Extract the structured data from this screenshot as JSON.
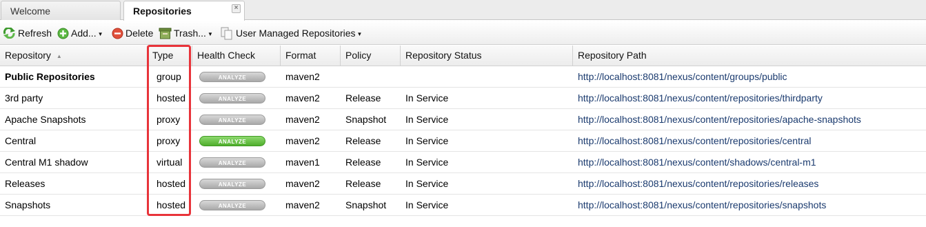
{
  "tabs": [
    {
      "label": "Welcome"
    },
    {
      "label": "Repositories",
      "close_glyph": "×"
    }
  ],
  "toolbar": {
    "refresh": "Refresh",
    "add": "Add...",
    "delete": "Delete",
    "trash": "Trash...",
    "user_managed": "User Managed Repositories"
  },
  "columns": {
    "repository": "Repository",
    "type": "Type",
    "health": "Health Check",
    "format": "Format",
    "policy": "Policy",
    "status": "Repository Status",
    "path": "Repository Path"
  },
  "rows": [
    {
      "name": "Public Repositories",
      "type": "group",
      "health": "ANALYZE",
      "health_state": "gray",
      "format": "maven2",
      "policy": "",
      "status": "",
      "path": "http://localhost:8081/nexus/content/groups/public"
    },
    {
      "name": "3rd party",
      "type": "hosted",
      "health": "ANALYZE",
      "health_state": "gray",
      "format": "maven2",
      "policy": "Release",
      "status": "In Service",
      "path": "http://localhost:8081/nexus/content/repositories/thirdparty"
    },
    {
      "name": "Apache Snapshots",
      "type": "proxy",
      "health": "ANALYZE",
      "health_state": "gray",
      "format": "maven2",
      "policy": "Snapshot",
      "status": "In Service",
      "path": "http://localhost:8081/nexus/content/repositories/apache-snapshots"
    },
    {
      "name": "Central",
      "type": "proxy",
      "health": "ANALYZE",
      "health_state": "green",
      "format": "maven2",
      "policy": "Release",
      "status": "In Service",
      "path": "http://localhost:8081/nexus/content/repositories/central"
    },
    {
      "name": "Central M1 shadow",
      "type": "virtual",
      "health": "ANALYZE",
      "health_state": "gray",
      "format": "maven1",
      "policy": "Release",
      "status": "In Service",
      "path": "http://localhost:8081/nexus/content/shadows/central-m1"
    },
    {
      "name": "Releases",
      "type": "hosted",
      "health": "ANALYZE",
      "health_state": "gray",
      "format": "maven2",
      "policy": "Release",
      "status": "In Service",
      "path": "http://localhost:8081/nexus/content/repositories/releases"
    },
    {
      "name": "Snapshots",
      "type": "hosted",
      "health": "ANALYZE",
      "health_state": "gray",
      "format": "maven2",
      "policy": "Snapshot",
      "status": "In Service",
      "path": "http://localhost:8081/nexus/content/repositories/snapshots"
    }
  ],
  "colors": {
    "highlight": "#e8333a",
    "analyze_active": "#4fae2c",
    "link": "#1a3a6e"
  }
}
